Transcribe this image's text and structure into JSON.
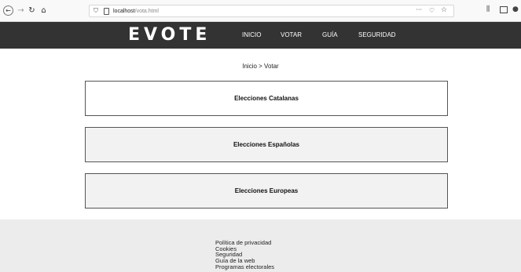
{
  "browser": {
    "url_host": "localhost",
    "url_path": "/vota.html",
    "icons": {
      "back": "back-arrow-icon",
      "forward": "forward-arrow-icon",
      "reload": "reload-icon",
      "home": "home-icon",
      "shield": "shield-icon",
      "page": "page-icon",
      "more": "more-dots-icon",
      "pocket": "pocket-icon",
      "bookmark": "star-icon",
      "library": "library-icon",
      "sidebar": "sidebar-icon",
      "menu": "account-icon"
    }
  },
  "header": {
    "logo": "EVOTE",
    "nav": {
      "inicio": "INICIO",
      "votar": "VOTAR",
      "guia": "GUÍA",
      "seguridad": "SEGURIDAD"
    },
    "background_color": "#333333"
  },
  "breadcrumb": "Inicio > Votar",
  "elections": [
    {
      "label": "Elecciones Catalanas"
    },
    {
      "label": "Elecciones Españolas"
    },
    {
      "label": "Elecciones Europeas"
    }
  ],
  "footer": {
    "links": [
      "Política de privacidad",
      "Cookies",
      "Seguridad",
      "Guía de la web",
      "Programas electorales"
    ]
  }
}
